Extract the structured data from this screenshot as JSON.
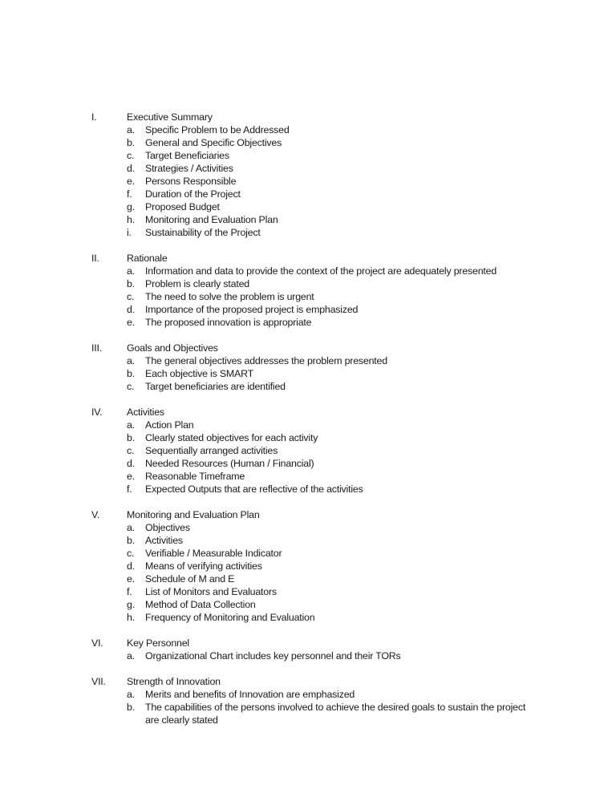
{
  "outline": {
    "sections": [
      {
        "numeral": "I.",
        "title": "Executive Summary",
        "items": [
          {
            "letter": "a.",
            "text": "Specific Problem to be Addressed"
          },
          {
            "letter": "b.",
            "text": "General and Specific Objectives"
          },
          {
            "letter": "c.",
            "text": "Target Beneficiaries"
          },
          {
            "letter": "d.",
            "text": "Strategies / Activities"
          },
          {
            "letter": "e.",
            "text": "Persons Responsible"
          },
          {
            "letter": "f.",
            "text": "Duration of the Project"
          },
          {
            "letter": "g.",
            "text": "Proposed Budget"
          },
          {
            "letter": "h.",
            "text": "Monitoring and Evaluation Plan"
          },
          {
            "letter": "i.",
            "text": "Sustainability of the Project"
          }
        ]
      },
      {
        "numeral": "II.",
        "title": "Rationale",
        "items": [
          {
            "letter": "a.",
            "text": "Information  and data to provide the context of the project are adequately presented"
          },
          {
            "letter": "b.",
            "text": "Problem is clearly stated"
          },
          {
            "letter": "c.",
            "text": "The need to solve the problem is urgent"
          },
          {
            "letter": "d.",
            "text": "Importance of the proposed project is emphasized"
          },
          {
            "letter": "e.",
            "text": "The proposed innovation is appropriate"
          }
        ]
      },
      {
        "numeral": "III.",
        "title": "Goals and Objectives",
        "items": [
          {
            "letter": "a.",
            "text": "The general objectives addresses the problem presented"
          },
          {
            "letter": "b.",
            "text": "Each objective is SMART"
          },
          {
            "letter": "c.",
            "text": "Target beneficiaries are identified"
          }
        ]
      },
      {
        "numeral": "IV.",
        "title": "Activities",
        "items": [
          {
            "letter": "a.",
            "text": "Action Plan"
          },
          {
            "letter": "b.",
            "text": "Clearly stated objectives for each activity"
          },
          {
            "letter": "c.",
            "text": "Sequentially arranged activities"
          },
          {
            "letter": "d.",
            "text": "Needed Resources (Human / Financial)"
          },
          {
            "letter": "e.",
            "text": "Reasonable Timeframe"
          },
          {
            "letter": "f.",
            "text": "Expected Outputs that are reflective of the activities"
          }
        ]
      },
      {
        "numeral": "V.",
        "title": "Monitoring and Evaluation Plan",
        "items": [
          {
            "letter": "a.",
            "text": "Objectives"
          },
          {
            "letter": "b.",
            "text": "Activities"
          },
          {
            "letter": "c.",
            "text": "Verifiable / Measurable Indicator"
          },
          {
            "letter": "d.",
            "text": "Means of verifying activities"
          },
          {
            "letter": "e.",
            "text": "Schedule of M and E"
          },
          {
            "letter": "f.",
            "text": "List of Monitors and Evaluators"
          },
          {
            "letter": "g.",
            "text": "Method of Data Collection"
          },
          {
            "letter": "h.",
            "text": "Frequency of Monitoring and Evaluation"
          }
        ]
      },
      {
        "numeral": "VI.",
        "title": "Key Personnel",
        "items": [
          {
            "letter": "a.",
            "text": "Organizational Chart includes key personnel and their TORs"
          }
        ]
      },
      {
        "numeral": "VII.",
        "title": "Strength of Innovation",
        "items": [
          {
            "letter": "a.",
            "text": "Merits and benefits of Innovation are emphasized"
          },
          {
            "letter": "b.",
            "text": "The capabilities of the persons involved to achieve the desired goals to sustain the project are clearly stated"
          }
        ]
      }
    ]
  }
}
